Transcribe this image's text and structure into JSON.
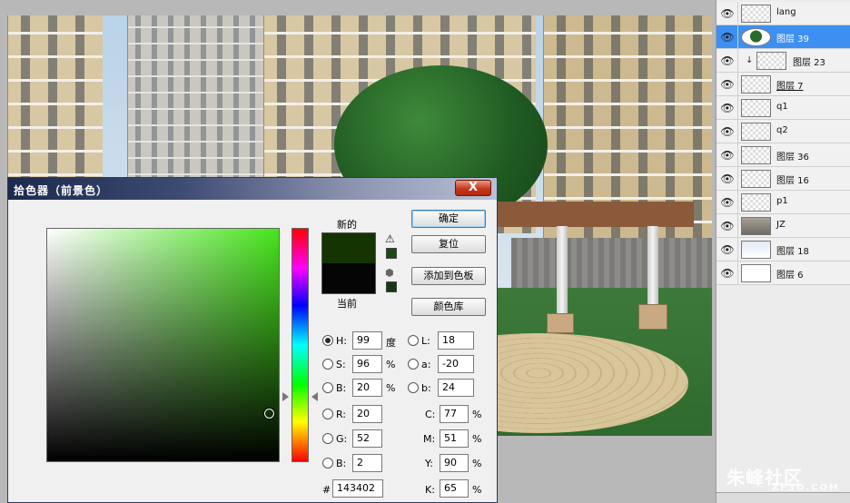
{
  "layers": [
    {
      "name": "lang",
      "visible": true,
      "thumb": "checker",
      "selected": false,
      "underline": false,
      "clipped": false
    },
    {
      "name": "图层 39",
      "visible": true,
      "thumb": "tree",
      "selected": true,
      "underline": false,
      "clipped": false
    },
    {
      "name": "图层 23",
      "visible": true,
      "thumb": "checker",
      "selected": false,
      "underline": false,
      "clipped": true
    },
    {
      "name": "图层 7",
      "visible": true,
      "thumb": "checker",
      "selected": false,
      "underline": true,
      "clipped": false
    },
    {
      "name": "q1",
      "visible": true,
      "thumb": "checker",
      "selected": false,
      "underline": false,
      "clipped": false
    },
    {
      "name": "q2",
      "visible": true,
      "thumb": "checker",
      "selected": false,
      "underline": false,
      "clipped": false
    },
    {
      "name": "图层 36",
      "visible": true,
      "thumb": "checker",
      "selected": false,
      "underline": false,
      "clipped": false
    },
    {
      "name": "图层 16",
      "visible": true,
      "thumb": "checker",
      "selected": false,
      "underline": false,
      "clipped": false
    },
    {
      "name": "p1",
      "visible": true,
      "thumb": "checker",
      "selected": false,
      "underline": false,
      "clipped": false
    },
    {
      "name": "JZ",
      "visible": true,
      "thumb": "photo",
      "selected": false,
      "underline": false,
      "clipped": false
    },
    {
      "name": "图层 18",
      "visible": true,
      "thumb": "light",
      "selected": false,
      "underline": false,
      "clipped": false
    },
    {
      "name": "图层 6",
      "visible": true,
      "thumb": "white",
      "selected": false,
      "underline": false,
      "clipped": false
    }
  ],
  "dialog": {
    "title": "拾色器（前景色）",
    "close": "X",
    "label_new": "新的",
    "label_current": "当前",
    "new_color": "#143402",
    "current_color": "#050505",
    "buttons": {
      "ok": "确定",
      "reset": "复位",
      "add_swatch": "添加到色板",
      "libraries": "颜色库"
    },
    "fields": {
      "H": {
        "label": "H:",
        "value": "99",
        "unit": "度",
        "selected": true
      },
      "S": {
        "label": "S:",
        "value": "96",
        "unit": "%"
      },
      "B": {
        "label": "B:",
        "value": "20",
        "unit": "%"
      },
      "R": {
        "label": "R:",
        "value": "20"
      },
      "G": {
        "label": "G:",
        "value": "52"
      },
      "Bb": {
        "label": "B:",
        "value": "2"
      },
      "L": {
        "label": "L:",
        "value": "18"
      },
      "a": {
        "label": "a:",
        "value": "-20"
      },
      "b": {
        "label": "b:",
        "value": "24"
      },
      "C": {
        "label": "C:",
        "value": "77",
        "unit": "%"
      },
      "M": {
        "label": "M:",
        "value": "51",
        "unit": "%"
      },
      "Y": {
        "label": "Y:",
        "value": "90",
        "unit": "%"
      },
      "K": {
        "label": "K:",
        "value": "65",
        "unit": "%"
      },
      "hex": {
        "label": "#",
        "value": "143402"
      }
    }
  },
  "watermark": {
    "zh": "朱峰社区",
    "en": "ZF3D.COM"
  }
}
